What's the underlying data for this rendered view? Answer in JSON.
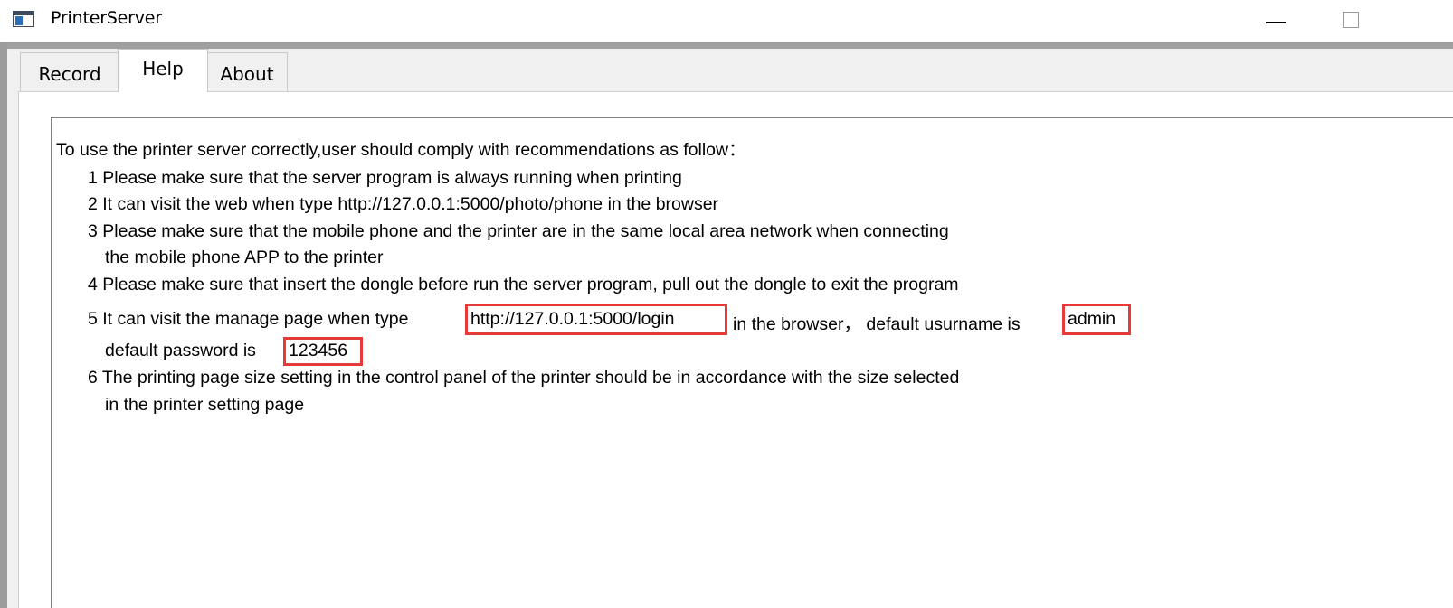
{
  "window": {
    "title": "PrinterServer"
  },
  "tabs": [
    {
      "label": "Record"
    },
    {
      "label": "Help"
    },
    {
      "label": "About"
    }
  ],
  "help": {
    "intro": "To use the printer server correctly,user should comply with recommendations as follow：",
    "line1": "1 Please make sure that the server program is always running when printing",
    "line2": "2 It can visit the web when type http://127.0.0.1:5000/photo/phone in the browser",
    "line3": "3 Please make sure that the mobile phone and the printer are in the same local area network when connecting",
    "line3_cont": "the mobile phone APP to the printer",
    "line4": "4 Please make sure that insert the dongle before run the server program, pull out the dongle to exit the program",
    "line5_prefix": "5 It can visit the manage page when type",
    "line5_url": "http://127.0.0.1:5000/login",
    "line5_middle": "in the browser， default usurname is",
    "line5_username": "admin",
    "line5_pass_label": "default password is",
    "line5_password": "123456",
    "line6": "6 The printing page size setting in the control panel of the printer should be in accordance with the size selected",
    "line6_cont": "in the printer setting page"
  },
  "colors": {
    "highlight_border": "#e53a3a",
    "titlebar_separator": "#a0a0a0"
  },
  "icons": {
    "app": "app-window-icon",
    "minimize": "minimize-icon",
    "maximize": "maximize-icon"
  }
}
